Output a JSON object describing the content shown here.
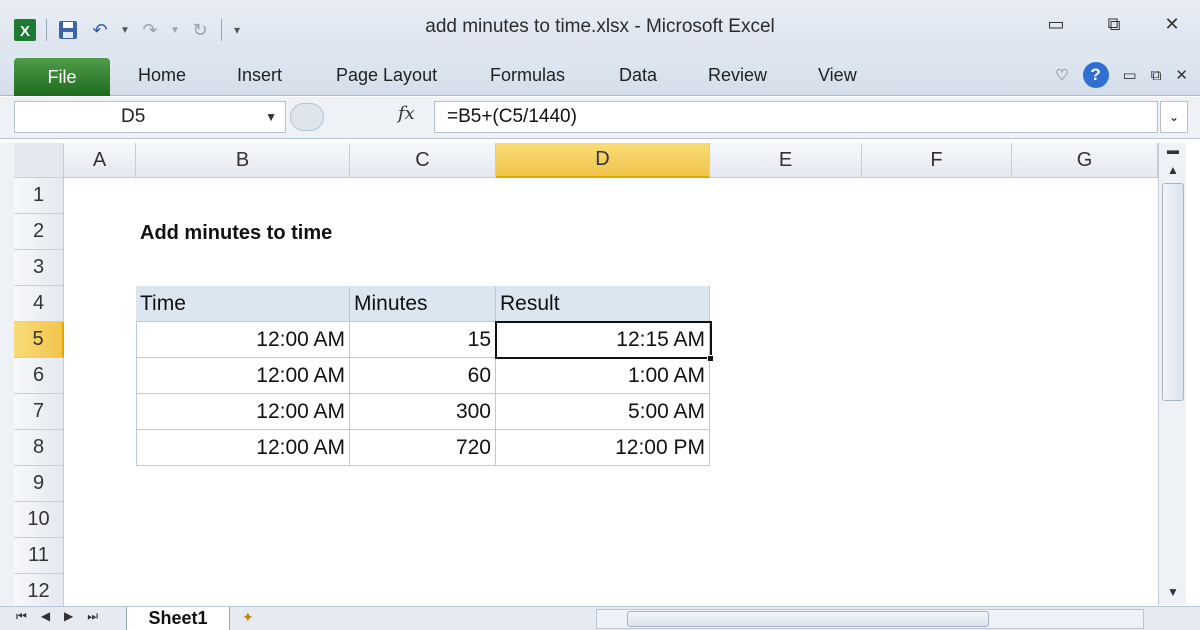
{
  "window": {
    "title": "add minutes to time.xlsx  -  Microsoft Excel",
    "controls": {
      "minimize": "▭",
      "restore": "⧉",
      "close": "✕"
    }
  },
  "ribbon": {
    "file_tab": "File",
    "tabs": [
      "Home",
      "Insert",
      "Page Layout",
      "Formulas",
      "Data",
      "Review",
      "View"
    ]
  },
  "formula_bar": {
    "name_box": "D5",
    "fx_label": "fx",
    "formula": "=B5+(C5/1440)"
  },
  "grid": {
    "columns": [
      "A",
      "B",
      "C",
      "D",
      "E",
      "F",
      "G"
    ],
    "selected_column": "D",
    "rows": [
      "1",
      "2",
      "3",
      "4",
      "5",
      "6",
      "7",
      "8",
      "9",
      "10",
      "11",
      "12"
    ],
    "selected_row": "5",
    "title_cell": "Add minutes to time",
    "table": {
      "headers": [
        "Time",
        "Minutes",
        "Result"
      ],
      "rows": [
        [
          "12:00 AM",
          "15",
          "12:15 AM"
        ],
        [
          "12:00 AM",
          "60",
          "1:00 AM"
        ],
        [
          "12:00 AM",
          "300",
          "5:00 AM"
        ],
        [
          "12:00 AM",
          "720",
          "12:00 PM"
        ]
      ]
    },
    "active_cell": "D5"
  },
  "sheet_tabs": {
    "active": "Sheet1"
  },
  "colors": {
    "file_tab": "#2e7d2c",
    "header_fill": "#dce6f1",
    "selection_header": "#f5cf5f"
  }
}
